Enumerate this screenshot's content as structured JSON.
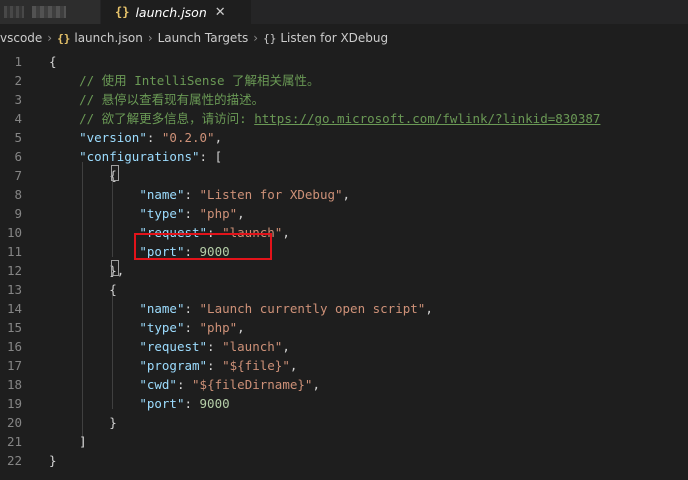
{
  "tabs": {
    "inactive_label": "",
    "active": {
      "icon_text": "{}",
      "title": "launch.json",
      "close": "✕"
    }
  },
  "breadcrumb": {
    "folder": "vscode",
    "sep": "›",
    "file_icon": "{}",
    "file": "launch.json",
    "section": "Launch Targets",
    "obj_icon": "{}",
    "item": "Listen for XDebug"
  },
  "lines": [
    {
      "n": "1",
      "parts": [
        [
          "p",
          "{"
        ]
      ]
    },
    {
      "n": "2",
      "parts": [
        [
          "c",
          "    // 使用 IntelliSense 了解相关属性。"
        ]
      ]
    },
    {
      "n": "3",
      "parts": [
        [
          "c",
          "    // 悬停以查看现有属性的描述。"
        ]
      ]
    },
    {
      "n": "4",
      "parts": [
        [
          "c",
          "    // 欲了解更多信息，请访问: "
        ],
        [
          "u",
          "https://go.microsoft.com/fwlink/?linkid=830387"
        ]
      ]
    },
    {
      "n": "5",
      "parts": [
        [
          "p",
          "    "
        ],
        [
          "k",
          "\"version\""
        ],
        [
          "p",
          ": "
        ],
        [
          "s",
          "\"0.2.0\""
        ],
        [
          "p",
          ","
        ]
      ]
    },
    {
      "n": "6",
      "parts": [
        [
          "p",
          "    "
        ],
        [
          "k",
          "\"configurations\""
        ],
        [
          "p",
          ": ["
        ]
      ]
    },
    {
      "n": "7",
      "parts": [
        [
          "p",
          "        {"
        ]
      ]
    },
    {
      "n": "8",
      "parts": [
        [
          "p",
          "            "
        ],
        [
          "k",
          "\"name\""
        ],
        [
          "p",
          ": "
        ],
        [
          "s",
          "\"Listen for XDebug\""
        ],
        [
          "p",
          ","
        ]
      ]
    },
    {
      "n": "9",
      "parts": [
        [
          "p",
          "            "
        ],
        [
          "k",
          "\"type\""
        ],
        [
          "p",
          ": "
        ],
        [
          "s",
          "\"php\""
        ],
        [
          "p",
          ","
        ]
      ]
    },
    {
      "n": "10",
      "parts": [
        [
          "p",
          "            "
        ],
        [
          "k",
          "\"request\""
        ],
        [
          "p",
          ": "
        ],
        [
          "s",
          "\"launch\""
        ],
        [
          "p",
          ","
        ]
      ]
    },
    {
      "n": "11",
      "parts": [
        [
          "p",
          "            "
        ],
        [
          "k",
          "\"port\""
        ],
        [
          "p",
          ": "
        ],
        [
          "n",
          "9000"
        ]
      ]
    },
    {
      "n": "12",
      "parts": [
        [
          "p",
          "        },"
        ]
      ]
    },
    {
      "n": "13",
      "parts": [
        [
          "p",
          "        {"
        ]
      ]
    },
    {
      "n": "14",
      "parts": [
        [
          "p",
          "            "
        ],
        [
          "k",
          "\"name\""
        ],
        [
          "p",
          ": "
        ],
        [
          "s",
          "\"Launch currently open script\""
        ],
        [
          "p",
          ","
        ]
      ]
    },
    {
      "n": "15",
      "parts": [
        [
          "p",
          "            "
        ],
        [
          "k",
          "\"type\""
        ],
        [
          "p",
          ": "
        ],
        [
          "s",
          "\"php\""
        ],
        [
          "p",
          ","
        ]
      ]
    },
    {
      "n": "16",
      "parts": [
        [
          "p",
          "            "
        ],
        [
          "k",
          "\"request\""
        ],
        [
          "p",
          ": "
        ],
        [
          "s",
          "\"launch\""
        ],
        [
          "p",
          ","
        ]
      ]
    },
    {
      "n": "17",
      "parts": [
        [
          "p",
          "            "
        ],
        [
          "k",
          "\"program\""
        ],
        [
          "p",
          ": "
        ],
        [
          "s",
          "\"${file}\""
        ],
        [
          "p",
          ","
        ]
      ]
    },
    {
      "n": "18",
      "parts": [
        [
          "p",
          "            "
        ],
        [
          "k",
          "\"cwd\""
        ],
        [
          "p",
          ": "
        ],
        [
          "s",
          "\"${fileDirname}\""
        ],
        [
          "p",
          ","
        ]
      ]
    },
    {
      "n": "19",
      "parts": [
        [
          "p",
          "            "
        ],
        [
          "k",
          "\"port\""
        ],
        [
          "p",
          ": "
        ],
        [
          "n",
          "9000"
        ]
      ]
    },
    {
      "n": "20",
      "parts": [
        [
          "p",
          "        }"
        ]
      ]
    },
    {
      "n": "21",
      "parts": [
        [
          "p",
          "    ]"
        ]
      ]
    },
    {
      "n": "22",
      "parts": [
        [
          "p",
          "}"
        ]
      ]
    }
  ],
  "colors": {
    "background": "#1e1e1e",
    "key": "#9cdcfe",
    "string": "#ce9178",
    "number": "#b5cea8",
    "comment": "#6a9955",
    "highlight_box": "#e3131a"
  }
}
